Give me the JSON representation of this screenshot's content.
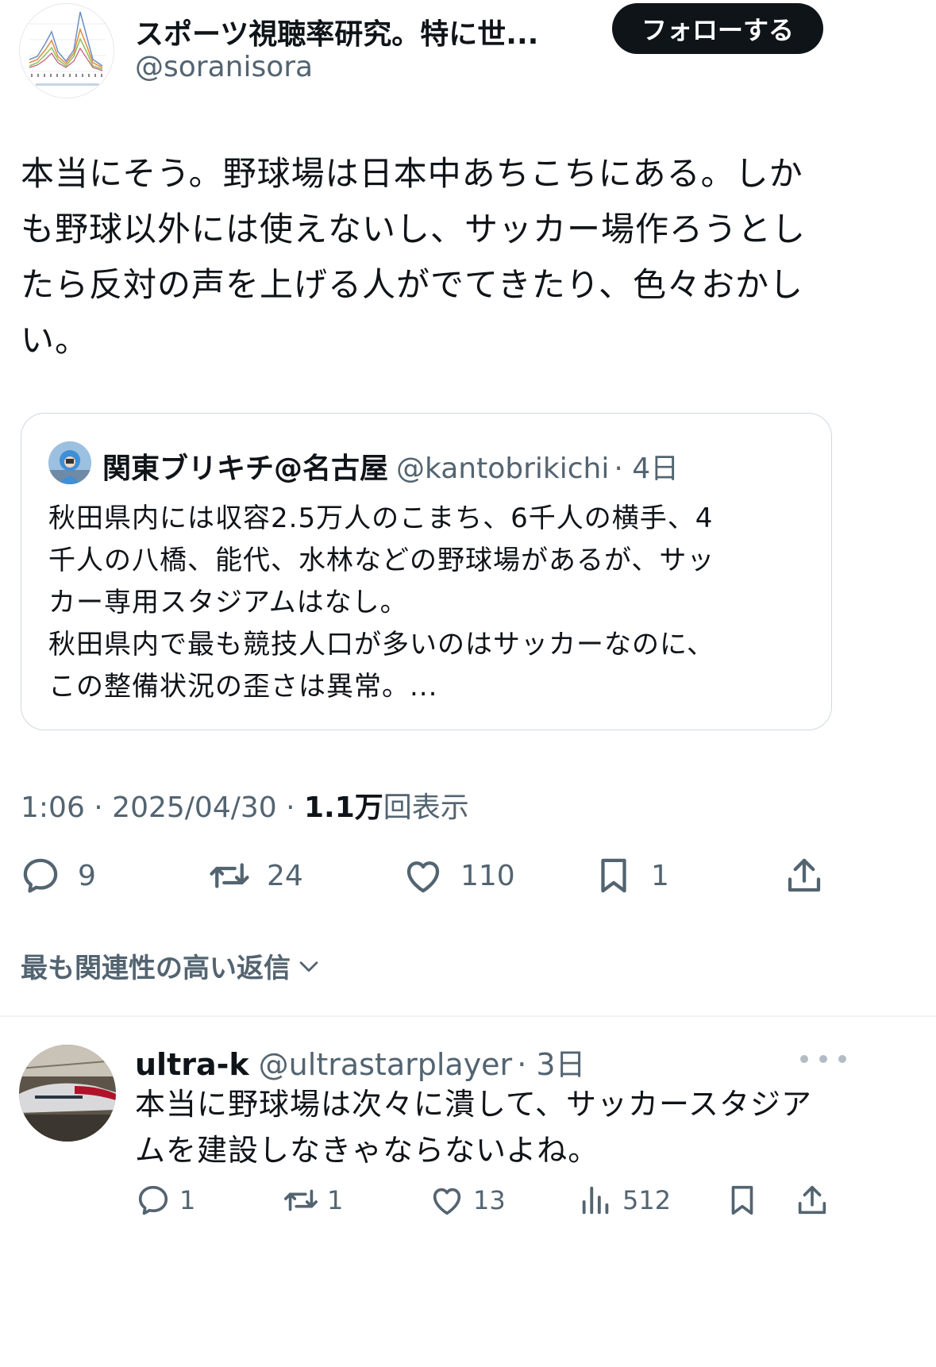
{
  "author": {
    "name": "スポーツ視聴率研究。特に世...",
    "handle": "@soranisora",
    "follow_label": "フォローする"
  },
  "tweet": {
    "lines": [
      "本当にそう。野球場は日本中あちこちにある。しか",
      "も野球以外には使えないし、サッカー場作ろうとし",
      "たら反対の声を上げる人がでてきたり、色々おかし",
      "い。"
    ]
  },
  "quote": {
    "name": "関東ブリキチ@名古屋",
    "handle": "@kantobrikichi",
    "time": "· 4日",
    "lines": [
      "秋田県内には収容2.5万人のこまち、6千人の横手、4",
      "千人の八橋、能代、水林などの野球場があるが、サッ",
      "カー専用スタジアムはなし。",
      "秋田県内で最も競技人口が多いのはサッカーなのに、",
      "この整備状況の歪さは異常。..."
    ]
  },
  "meta": {
    "time": "1:06 · 2025/04/30 · ",
    "views_count": "1.1万",
    "views_label": "回表示"
  },
  "actions": {
    "replies": "9",
    "retweets": "24",
    "likes": "110",
    "bookmarks": "1"
  },
  "sort": {
    "label": "最も関連性の高い返信"
  },
  "reply": {
    "name": "ultra-k",
    "handle": "@ultrastarplayer",
    "time": "· 3日",
    "lines": [
      "本当に野球場は次々に潰して、サッカースタジア",
      "ムを建設しなきゃならないよね。"
    ],
    "actions": {
      "replies": "1",
      "retweets": "1",
      "likes": "13",
      "views": "512"
    }
  },
  "icons": [
    "reply-icon",
    "retweet-icon",
    "like-icon",
    "bookmark-icon",
    "share-icon",
    "chevron-down-icon",
    "more-icon",
    "views-icon"
  ],
  "colors": {
    "text": "#0f1419",
    "secondary": "#536471",
    "border": "#cfd9de",
    "button_bg": "#0f1419"
  }
}
